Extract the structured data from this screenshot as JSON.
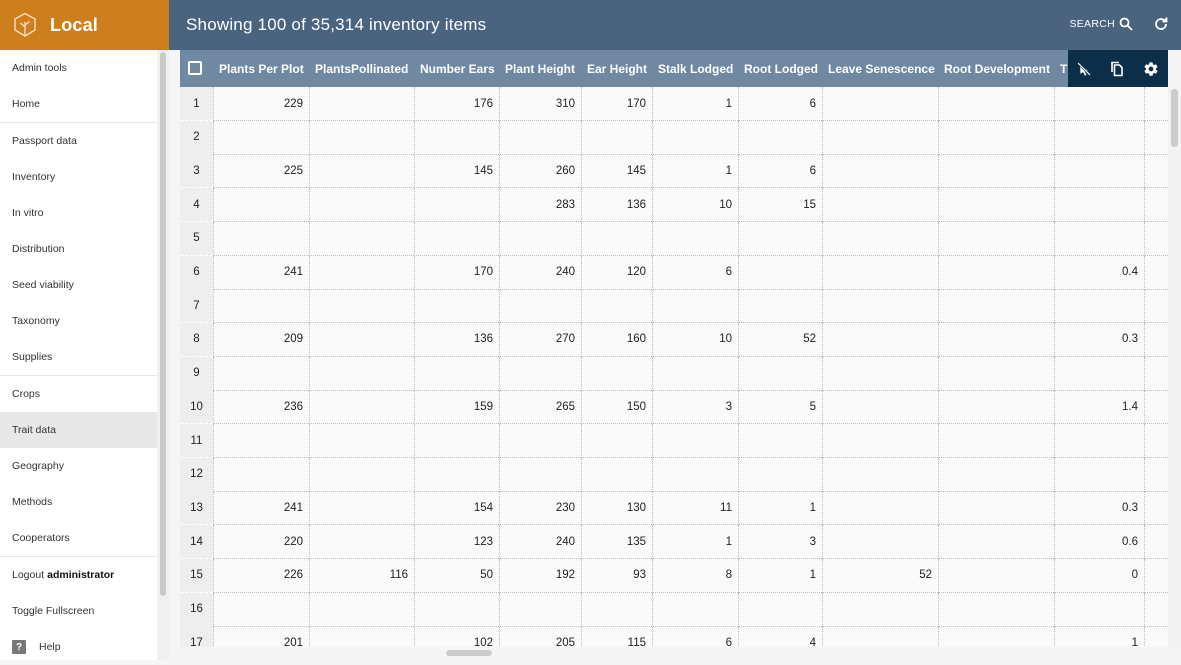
{
  "brand": {
    "name": "Local",
    "icon": "tree-hexagon-icon"
  },
  "header": {
    "title": "Showing 100 of 35,314 inventory items",
    "search_label": "SEARCH",
    "search_icon": "search-icon",
    "refresh_icon": "refresh-icon"
  },
  "sidebar": {
    "groups": [
      [
        {
          "label": "Admin tools"
        },
        {
          "label": "Home"
        }
      ],
      [
        {
          "label": "Passport data"
        },
        {
          "label": "Inventory"
        },
        {
          "label": "In vitro"
        },
        {
          "label": "Distribution"
        },
        {
          "label": "Seed viability"
        },
        {
          "label": "Taxonomy"
        },
        {
          "label": "Supplies"
        }
      ],
      [
        {
          "label": "Crops"
        },
        {
          "label": "Trait data",
          "active": true
        },
        {
          "label": "Geography"
        },
        {
          "label": "Methods"
        },
        {
          "label": "Cooperators"
        }
      ],
      [
        {
          "label": "Logout",
          "bold": "administrator"
        },
        {
          "label": "Toggle Fullscreen"
        },
        {
          "label": "Help",
          "icon": "help-icon"
        }
      ]
    ]
  },
  "grid": {
    "columns": [
      "Plants Per Plot",
      "PlantsPollinated",
      "Number Ears",
      "Plant Height",
      "Ear Height",
      "Stalk Lodged",
      "Root Lodged",
      "Leave Senescence",
      "Root Development",
      "T",
      ""
    ],
    "toolbar_icons": [
      "deselect-cursor-icon",
      "copy-icon",
      "settings-gear-icon"
    ],
    "rows": [
      {
        "n": "1",
        "cells": [
          "229",
          "",
          "176",
          "310",
          "170",
          "1",
          "6",
          "",
          "",
          "",
          ""
        ]
      },
      {
        "n": "2",
        "cells": [
          "",
          "",
          "",
          "",
          "",
          "",
          "",
          "",
          "",
          "",
          ""
        ]
      },
      {
        "n": "3",
        "cells": [
          "225",
          "",
          "145",
          "260",
          "145",
          "1",
          "6",
          "",
          "",
          "",
          ""
        ]
      },
      {
        "n": "4",
        "cells": [
          "",
          "",
          "",
          "283",
          "136",
          "10",
          "15",
          "",
          "",
          "",
          ""
        ]
      },
      {
        "n": "5",
        "cells": [
          "",
          "",
          "",
          "",
          "",
          "",
          "",
          "",
          "",
          "",
          ""
        ]
      },
      {
        "n": "6",
        "cells": [
          "241",
          "",
          "170",
          "240",
          "120",
          "6",
          "",
          "",
          "",
          "0.4",
          ""
        ]
      },
      {
        "n": "7",
        "cells": [
          "",
          "",
          "",
          "",
          "",
          "",
          "",
          "",
          "",
          "",
          ""
        ]
      },
      {
        "n": "8",
        "cells": [
          "209",
          "",
          "136",
          "270",
          "160",
          "10",
          "52",
          "",
          "",
          "0.3",
          ""
        ]
      },
      {
        "n": "9",
        "cells": [
          "",
          "",
          "",
          "",
          "",
          "",
          "",
          "",
          "",
          "",
          ""
        ]
      },
      {
        "n": "10",
        "cells": [
          "236",
          "",
          "159",
          "265",
          "150",
          "3",
          "5",
          "",
          "",
          "1.4",
          ""
        ]
      },
      {
        "n": "11",
        "cells": [
          "",
          "",
          "",
          "",
          "",
          "",
          "",
          "",
          "",
          "",
          ""
        ]
      },
      {
        "n": "12",
        "cells": [
          "",
          "",
          "",
          "",
          "",
          "",
          "",
          "",
          "",
          "",
          ""
        ]
      },
      {
        "n": "13",
        "cells": [
          "241",
          "",
          "154",
          "230",
          "130",
          "11",
          "1",
          "",
          "",
          "0.3",
          ""
        ]
      },
      {
        "n": "14",
        "cells": [
          "220",
          "",
          "123",
          "240",
          "135",
          "1",
          "3",
          "",
          "",
          "0.6",
          ""
        ]
      },
      {
        "n": "15",
        "cells": [
          "226",
          "116",
          "50",
          "192",
          "93",
          "8",
          "1",
          "52",
          "",
          "0",
          ""
        ]
      },
      {
        "n": "16",
        "cells": [
          "",
          "",
          "",
          "",
          "",
          "",
          "",
          "",
          "",
          "",
          ""
        ]
      },
      {
        "n": "17",
        "cells": [
          "201",
          "",
          "102",
          "205",
          "115",
          "6",
          "4",
          "",
          "",
          "1",
          ""
        ]
      }
    ]
  }
}
